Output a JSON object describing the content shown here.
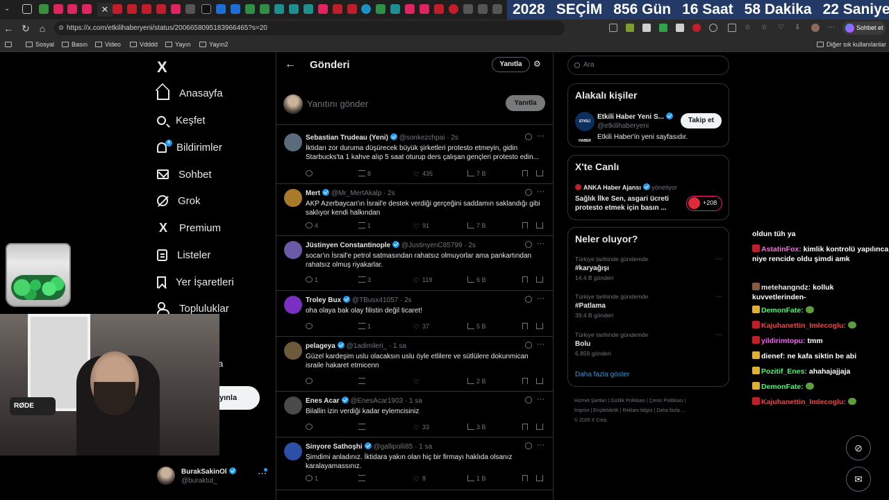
{
  "browser": {
    "countdown": [
      "2028",
      "SEÇİM",
      "856 Gün",
      "16 Saat",
      "58 Dakika",
      "22 Saniye"
    ],
    "url": "https://x.com/etkilihaberyeni/status/2006658095183966465?s=20",
    "chat_button": "Sohbet et",
    "bookmarks": [
      "Sosyal",
      "Basın",
      "Video",
      "Vdddd",
      "Yayın",
      "Yayın2"
    ],
    "other_bookmarks": "Diğer sık kullanılanlar"
  },
  "sidebar": {
    "logo": "X",
    "items": [
      {
        "label": "Anasayfa",
        "icon": "home-icon"
      },
      {
        "label": "Keşfet",
        "icon": "search-icon"
      },
      {
        "label": "Bildirimler",
        "icon": "bell-icon"
      },
      {
        "label": "Sohbet",
        "icon": "mail-icon"
      },
      {
        "label": "Grok",
        "icon": "grok-icon"
      },
      {
        "label": "Premium",
        "icon": "x-icon"
      },
      {
        "label": "Listeler",
        "icon": "list-icon"
      },
      {
        "label": "Yer İşaretleri",
        "icon": "bookmark-icon"
      },
      {
        "label": "Topluluklar",
        "icon": "communities-icon"
      }
    ],
    "notif_badge": "4",
    "partial_a": "a",
    "post_button_partial": "yınla",
    "profile": {
      "name": "BurakSakinOl",
      "handle": "@buraktut_"
    }
  },
  "overlay": {
    "mic_brand": "RØDE"
  },
  "main": {
    "header_title": "Gönderi",
    "reply_button": "Yanıtla",
    "composer_placeholder": "Yanıtını gönder",
    "composer_button": "Yanıtla",
    "tweets": [
      {
        "name": "Sebastian Trudeau (Yeni)",
        "handle": "@sonkezchpai · 2s",
        "text": "İktidarı zor duruma düşürecek büyük şirketleri protesto etmeyin, gidin Starbucks'ta 1 kahve alıp 5 saat oturup ders çalışan gençleri protesto edin...",
        "reply": "",
        "rt": "8",
        "like": "435",
        "views": "7 B"
      },
      {
        "name": "Mert",
        "handle": "@Mr_MertAkalp · 2s",
        "text": "AKP Azerbaycan'ın İsrail'e destek verdiği gerçeğini saddamın saklandığı gibi saklıyor kendi halkından",
        "reply": "4",
        "rt": "1",
        "like": "91",
        "views": "7 B"
      },
      {
        "name": "Jüstinyen Constantinople",
        "handle": "@JustinyenC85799 · 2s",
        "text": "socar'ın İsrail'e petrol satmasından rahatsız olmuyorlar ama pankartından rahatsız olmuş riyakarlar.",
        "reply": "1",
        "rt": "3",
        "like": "119",
        "views": "6 B"
      },
      {
        "name": "Troley Bux",
        "handle": "@TBusx41057 · 2s",
        "text": "oha olaya bak olay filistin değil ticaret!",
        "reply": "",
        "rt": "1",
        "like": "37",
        "views": "5 B"
      },
      {
        "name": "pelageya",
        "handle": "@1adimileri_ · 1 sa",
        "text": "Güzel kardeşim uslu olacaksın uslu öyle etlilere ve sütlülere dokunmican israile hakaret etmicenn",
        "reply": "",
        "rt": "",
        "like": "",
        "views": "2 B"
      },
      {
        "name": "Enes Acar",
        "handle": "@EnesAcar1903 · 1 sa",
        "text": "Bilallin izin verdiği kadar eylemcisiniz",
        "reply": "",
        "rt": "",
        "like": "33",
        "views": "3 B"
      },
      {
        "name": "Sinyore Sathoşhi",
        "handle": "@gallipolli85 · 1 sa",
        "text": "Şimdimi anladınız. İktidara yakın olan hiç bir firmayı haklıda olsanız karalayamassınız.",
        "reply": "1",
        "rt": "",
        "like": "8",
        "views": "1 B"
      }
    ]
  },
  "right": {
    "search_placeholder": "Ara",
    "relevant": {
      "title": "Alakalı kişiler",
      "avatar_text": "ETKİLİ HABER",
      "name": "Etkili Haber Yeni S...",
      "handle": "@etkilihaberyeni",
      "bio": "Etkili Haber'in yeni sayfasıdır.",
      "follow": "Takip et"
    },
    "live": {
      "title": "X'te Canlı",
      "host": "ANKA Haber Ajansı",
      "host_suffix": "yönetiyor",
      "stream_title": "Sağlık İlke Sen, asgari ücreti protesto etmek için basın ...",
      "count": "+208"
    },
    "trends": {
      "title": "Neler oluyor?",
      "items": [
        {
          "meta": "Türkiye tarihinde gündemde",
          "name": "#karyağışı",
          "count": "14,4 B gönderi"
        },
        {
          "meta": "Türkiye tarihinde gündemde",
          "name": "#Patlama",
          "count": "39,4 B gönderi"
        },
        {
          "meta": "Türkiye tarihinde gündemde",
          "name": "Bolu",
          "count": "6.859 gönderi"
        }
      ],
      "show_more": "Daha fazla göster"
    },
    "footer": [
      "Hizmet Şartları",
      "Gizlilik Politikası",
      "Çerez Politikası",
      "Imprint",
      "Erişilebilirlik",
      "Reklam bilgisi",
      "Daha fazla ...",
      "© 2026 X Corp."
    ]
  },
  "chat": [
    {
      "user": "",
      "text": "oldun tüh ya",
      "color": "#ffffff"
    },
    {
      "user": "AstatinFox:",
      "text": "kimlik kontrolü yapılınca niye rencide oldu şimdi amk",
      "color": "#ff69e4"
    },
    {
      "user": "metehangndz:",
      "text": "kolluk kuvvetlerinden-",
      "color": "#e8e8e8"
    },
    {
      "user": "DemonFate:",
      "text": "",
      "color": "#39ff6a"
    },
    {
      "user": "Kajuhanettin_Imlecoglu:",
      "text": "",
      "color": "#ff3b3b"
    },
    {
      "user": "yildirimtopu:",
      "text": "tmm",
      "color": "#ff59ff"
    },
    {
      "user": "dienef:",
      "text": "ne kafa siktin be abi",
      "color": "#ffffff"
    },
    {
      "user": "Pozitif_Enes:",
      "text": "ahahajajjaja",
      "color": "#39ff6a"
    },
    {
      "user": "DemonFate:",
      "text": "",
      "color": "#39ff6a"
    },
    {
      "user": "Kajuhanettin_Imlecoglu:",
      "text": "",
      "color": "#ff3b3b"
    }
  ]
}
